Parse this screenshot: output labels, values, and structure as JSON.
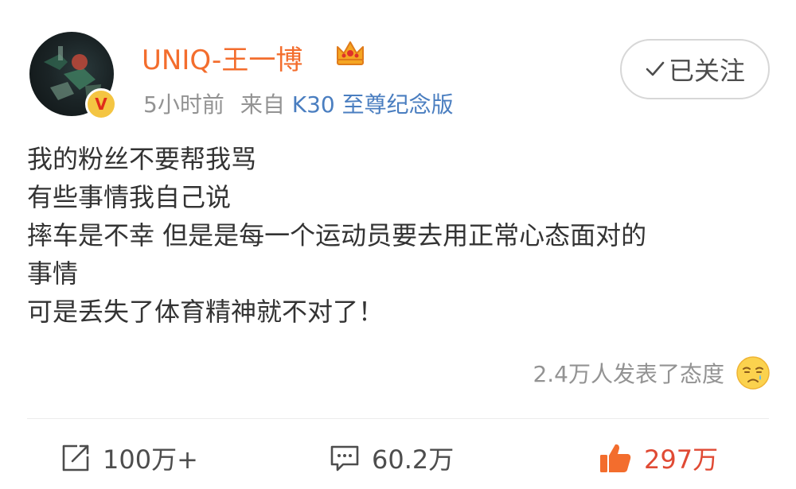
{
  "post": {
    "username": "UNIQ-王一博",
    "verified_badge": "V",
    "time": "5小时前",
    "source_prefix": "来自",
    "source_device": "K30 至尊纪念版",
    "follow_label": "已关注",
    "content_lines": [
      "我的粉丝不要帮我骂",
      "有些事情我自己说",
      "摔车是不幸 但是是每一个运动员要去用正常心态面对的",
      "事情",
      "可是丢失了体育精神就不对了！"
    ],
    "reaction_text": "2.4万人发表了态度"
  },
  "actions": {
    "repost_count": "100万+",
    "comment_count": "60.2万",
    "like_count": "297万"
  },
  "colors": {
    "username": "#f36d2d",
    "source_device": "#4a7ec0",
    "like": "#e04a34",
    "muted": "#939393",
    "badge": "#f4c542"
  },
  "icons": [
    "check-icon",
    "crown-icon",
    "verified-badge-icon",
    "crying-face-emoji-icon",
    "share-icon",
    "comment-icon",
    "like-icon"
  ]
}
